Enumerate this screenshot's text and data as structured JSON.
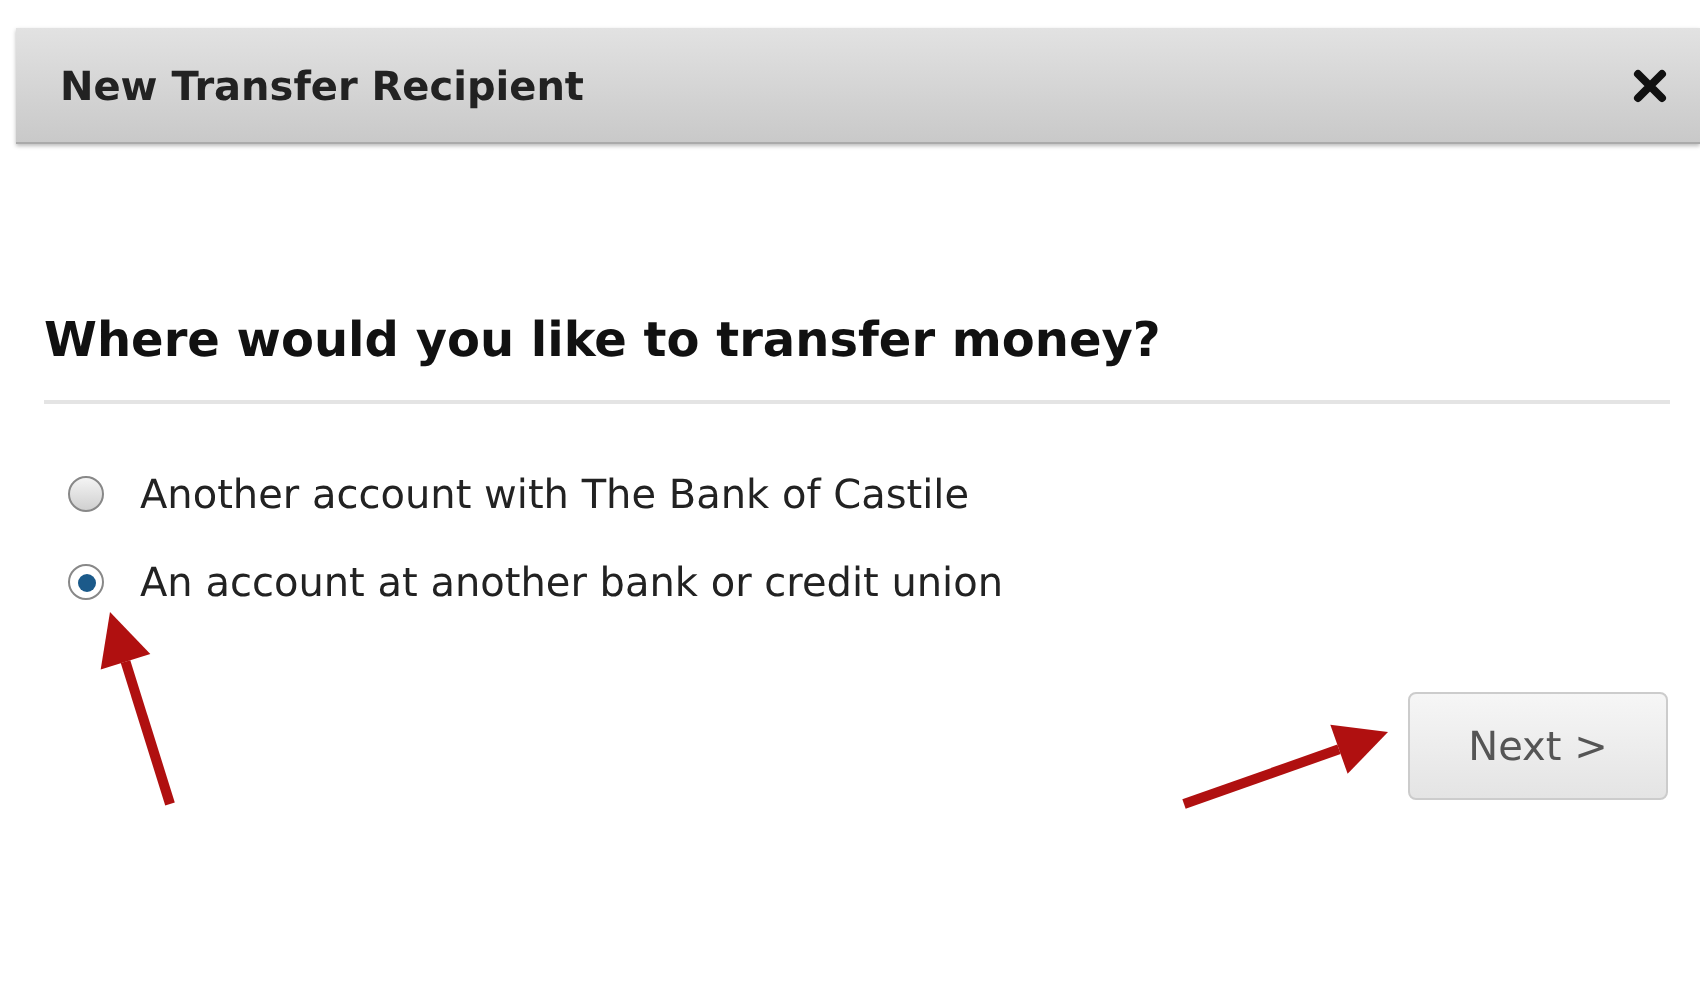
{
  "dialog": {
    "title": "New Transfer Recipient"
  },
  "question": "Where would you like to transfer money?",
  "options": [
    {
      "label": "Another account with The Bank of Castile",
      "selected": false
    },
    {
      "label": "An account at another bank or credit union",
      "selected": true
    }
  ],
  "next_button": {
    "label": "Next >"
  }
}
